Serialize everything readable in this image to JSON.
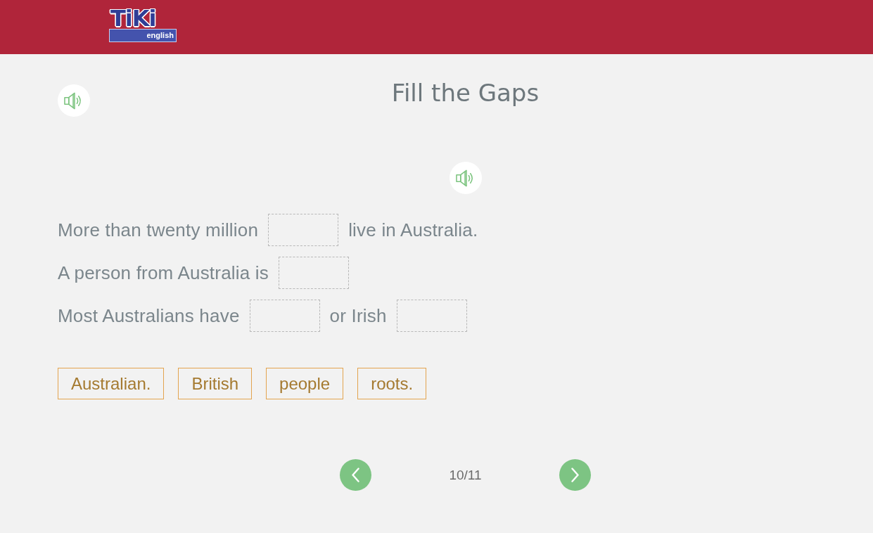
{
  "header": {
    "logo": {
      "title": "TiKi",
      "subtitle": "english"
    }
  },
  "exercise": {
    "title": "Fill the Gaps"
  },
  "sentences": [
    {
      "parts": [
        {
          "kind": "text",
          "text": "More than twenty million"
        },
        {
          "kind": "gap"
        },
        {
          "kind": "text",
          "text": "live in Australia."
        }
      ]
    },
    {
      "parts": [
        {
          "kind": "text",
          "text": "A person from Australia is"
        },
        {
          "kind": "gap"
        }
      ]
    },
    {
      "parts": [
        {
          "kind": "text",
          "text": "Most Australians have"
        },
        {
          "kind": "gap"
        },
        {
          "kind": "text",
          "text": "or Irish"
        },
        {
          "kind": "gap"
        }
      ]
    }
  ],
  "word_bank": [
    "Australian.",
    "British",
    "people",
    "roots."
  ],
  "pagination": {
    "counter": "10/11"
  }
}
